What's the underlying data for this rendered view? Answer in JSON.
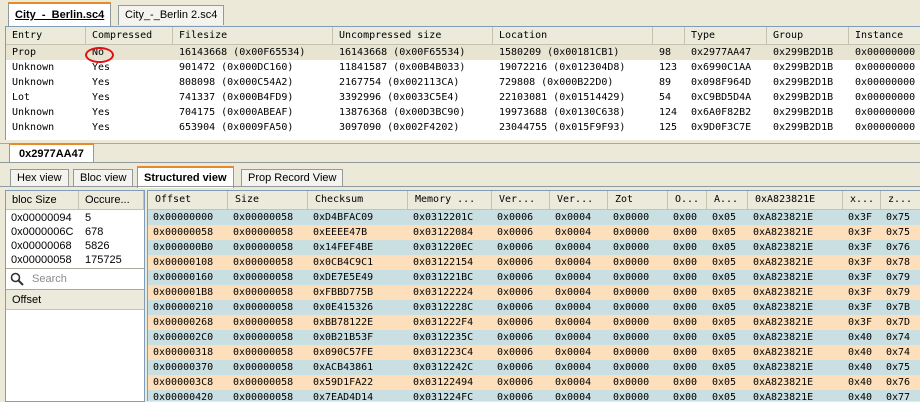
{
  "file_tabs": [
    "City_-_Berlin.sc4",
    "City_-_Berlin 2.sc4"
  ],
  "entry_table": {
    "headers": [
      "Entry",
      "Compressed",
      "Filesize",
      "Uncompressed size",
      "Location",
      "",
      "Type",
      "Group",
      "Instance"
    ],
    "rows": [
      [
        "Prop",
        "No",
        "16143668 (0x00F65534)",
        "16143668 (0x00F65534)",
        "1580209 (0x00181CB1)",
        "98",
        "0x2977AA47",
        "0x299B2D1B",
        "0x00000000"
      ],
      [
        "Unknown",
        "Yes",
        "901472 (0x000DC160)",
        "11841587 (0x00B4B033)",
        "19072216 (0x012304D8)",
        "123",
        "0x6990C1AA",
        "0x299B2D1B",
        "0x00000000"
      ],
      [
        "Unknown",
        "Yes",
        "808098 (0x000C54A2)",
        "2167754 (0x002113CA)",
        "729808 (0x000B22D0)",
        "89",
        "0x098F964D",
        "0x299B2D1B",
        "0x00000000"
      ],
      [
        "Lot",
        "Yes",
        "741337 (0x000B4FD9)",
        "3392996 (0x0033C5E4)",
        "22103081 (0x01514429)",
        "54",
        "0xC9BD5D4A",
        "0x299B2D1B",
        "0x00000000"
      ],
      [
        "Unknown",
        "Yes",
        "704175 (0x000ABEAF)",
        "13876368 (0x00D3BC90)",
        "19973688 (0x0130C638)",
        "124",
        "0x6A0F82B2",
        "0x299B2D1B",
        "0x00000000"
      ],
      [
        "Unknown",
        "Yes",
        "653904 (0x0009FA50)",
        "3097090 (0x002F4202)",
        "23044755 (0x015F9F93)",
        "125",
        "0x9D0F3C7E",
        "0x299B2D1B",
        "0x00000000"
      ]
    ]
  },
  "instance_tab": "0x2977AA47",
  "view_tabs": [
    "Hex view",
    "Bloc view",
    "Structured view",
    "Prop Record View"
  ],
  "bloc_table": {
    "headers": [
      "bloc Size",
      "Occure..."
    ],
    "rows": [
      [
        "0x00000094",
        "5"
      ],
      [
        "0x0000006C",
        "678"
      ],
      [
        "0x00000068",
        "5826"
      ],
      [
        "0x00000058",
        "175725"
      ]
    ]
  },
  "search": {
    "placeholder": "Search"
  },
  "offset_header": "Offset",
  "struct_table": {
    "headers": [
      "Offset",
      "Size",
      "Checksum",
      "Memory ...",
      "Ver...",
      "Ver...",
      "Zot",
      "O...",
      "A...",
      "0xA823821E",
      "x...",
      "z..."
    ],
    "rows": [
      [
        "0x00000000",
        "0x00000058",
        "0xD4BFAC09",
        "0x0312201C",
        "0x0006",
        "0x0004",
        "0x0000",
        "0x00",
        "0x05",
        "0xA823821E",
        "0x3F",
        "0x75"
      ],
      [
        "0x00000058",
        "0x00000058",
        "0xEEEE47B",
        "0x03122084",
        "0x0006",
        "0x0004",
        "0x0000",
        "0x00",
        "0x05",
        "0xA823821E",
        "0x3F",
        "0x75"
      ],
      [
        "0x000000B0",
        "0x00000058",
        "0x14FEF4BE",
        "0x031220EC",
        "0x0006",
        "0x0004",
        "0x0000",
        "0x00",
        "0x05",
        "0xA823821E",
        "0x3F",
        "0x76"
      ],
      [
        "0x00000108",
        "0x00000058",
        "0x0CB4C9C1",
        "0x03122154",
        "0x0006",
        "0x0004",
        "0x0000",
        "0x00",
        "0x05",
        "0xA823821E",
        "0x3F",
        "0x78"
      ],
      [
        "0x00000160",
        "0x00000058",
        "0xDE7E5E49",
        "0x031221BC",
        "0x0006",
        "0x0004",
        "0x0000",
        "0x00",
        "0x05",
        "0xA823821E",
        "0x3F",
        "0x79"
      ],
      [
        "0x000001B8",
        "0x00000058",
        "0xFBBD775B",
        "0x03122224",
        "0x0006",
        "0x0004",
        "0x0000",
        "0x00",
        "0x05",
        "0xA823821E",
        "0x3F",
        "0x79"
      ],
      [
        "0x00000210",
        "0x00000058",
        "0x0E415326",
        "0x0312228C",
        "0x0006",
        "0x0004",
        "0x0000",
        "0x00",
        "0x05",
        "0xA823821E",
        "0x3F",
        "0x7B"
      ],
      [
        "0x00000268",
        "0x00000058",
        "0xBB78122E",
        "0x031222F4",
        "0x0006",
        "0x0004",
        "0x0000",
        "0x00",
        "0x05",
        "0xA823821E",
        "0x3F",
        "0x7D"
      ],
      [
        "0x000002C0",
        "0x00000058",
        "0x0B21B53F",
        "0x0312235C",
        "0x0006",
        "0x0004",
        "0x0000",
        "0x00",
        "0x05",
        "0xA823821E",
        "0x40",
        "0x74"
      ],
      [
        "0x00000318",
        "0x00000058",
        "0x090C57FE",
        "0x031223C4",
        "0x0006",
        "0x0004",
        "0x0000",
        "0x00",
        "0x05",
        "0xA823821E",
        "0x40",
        "0x74"
      ],
      [
        "0x00000370",
        "0x00000058",
        "0xACB43861",
        "0x0312242C",
        "0x0006",
        "0x0004",
        "0x0000",
        "0x00",
        "0x05",
        "0xA823821E",
        "0x40",
        "0x75"
      ],
      [
        "0x000003C8",
        "0x00000058",
        "0x59D1FA22",
        "0x03122494",
        "0x0006",
        "0x0004",
        "0x0000",
        "0x00",
        "0x05",
        "0xA823821E",
        "0x40",
        "0x76"
      ],
      [
        "0x00000420",
        "0x00000058",
        "0x7EAD4D14",
        "0x031224FC",
        "0x0006",
        "0x0004",
        "0x0000",
        "0x00",
        "0x05",
        "0xA823821E",
        "0x40",
        "0x77"
      ]
    ]
  }
}
